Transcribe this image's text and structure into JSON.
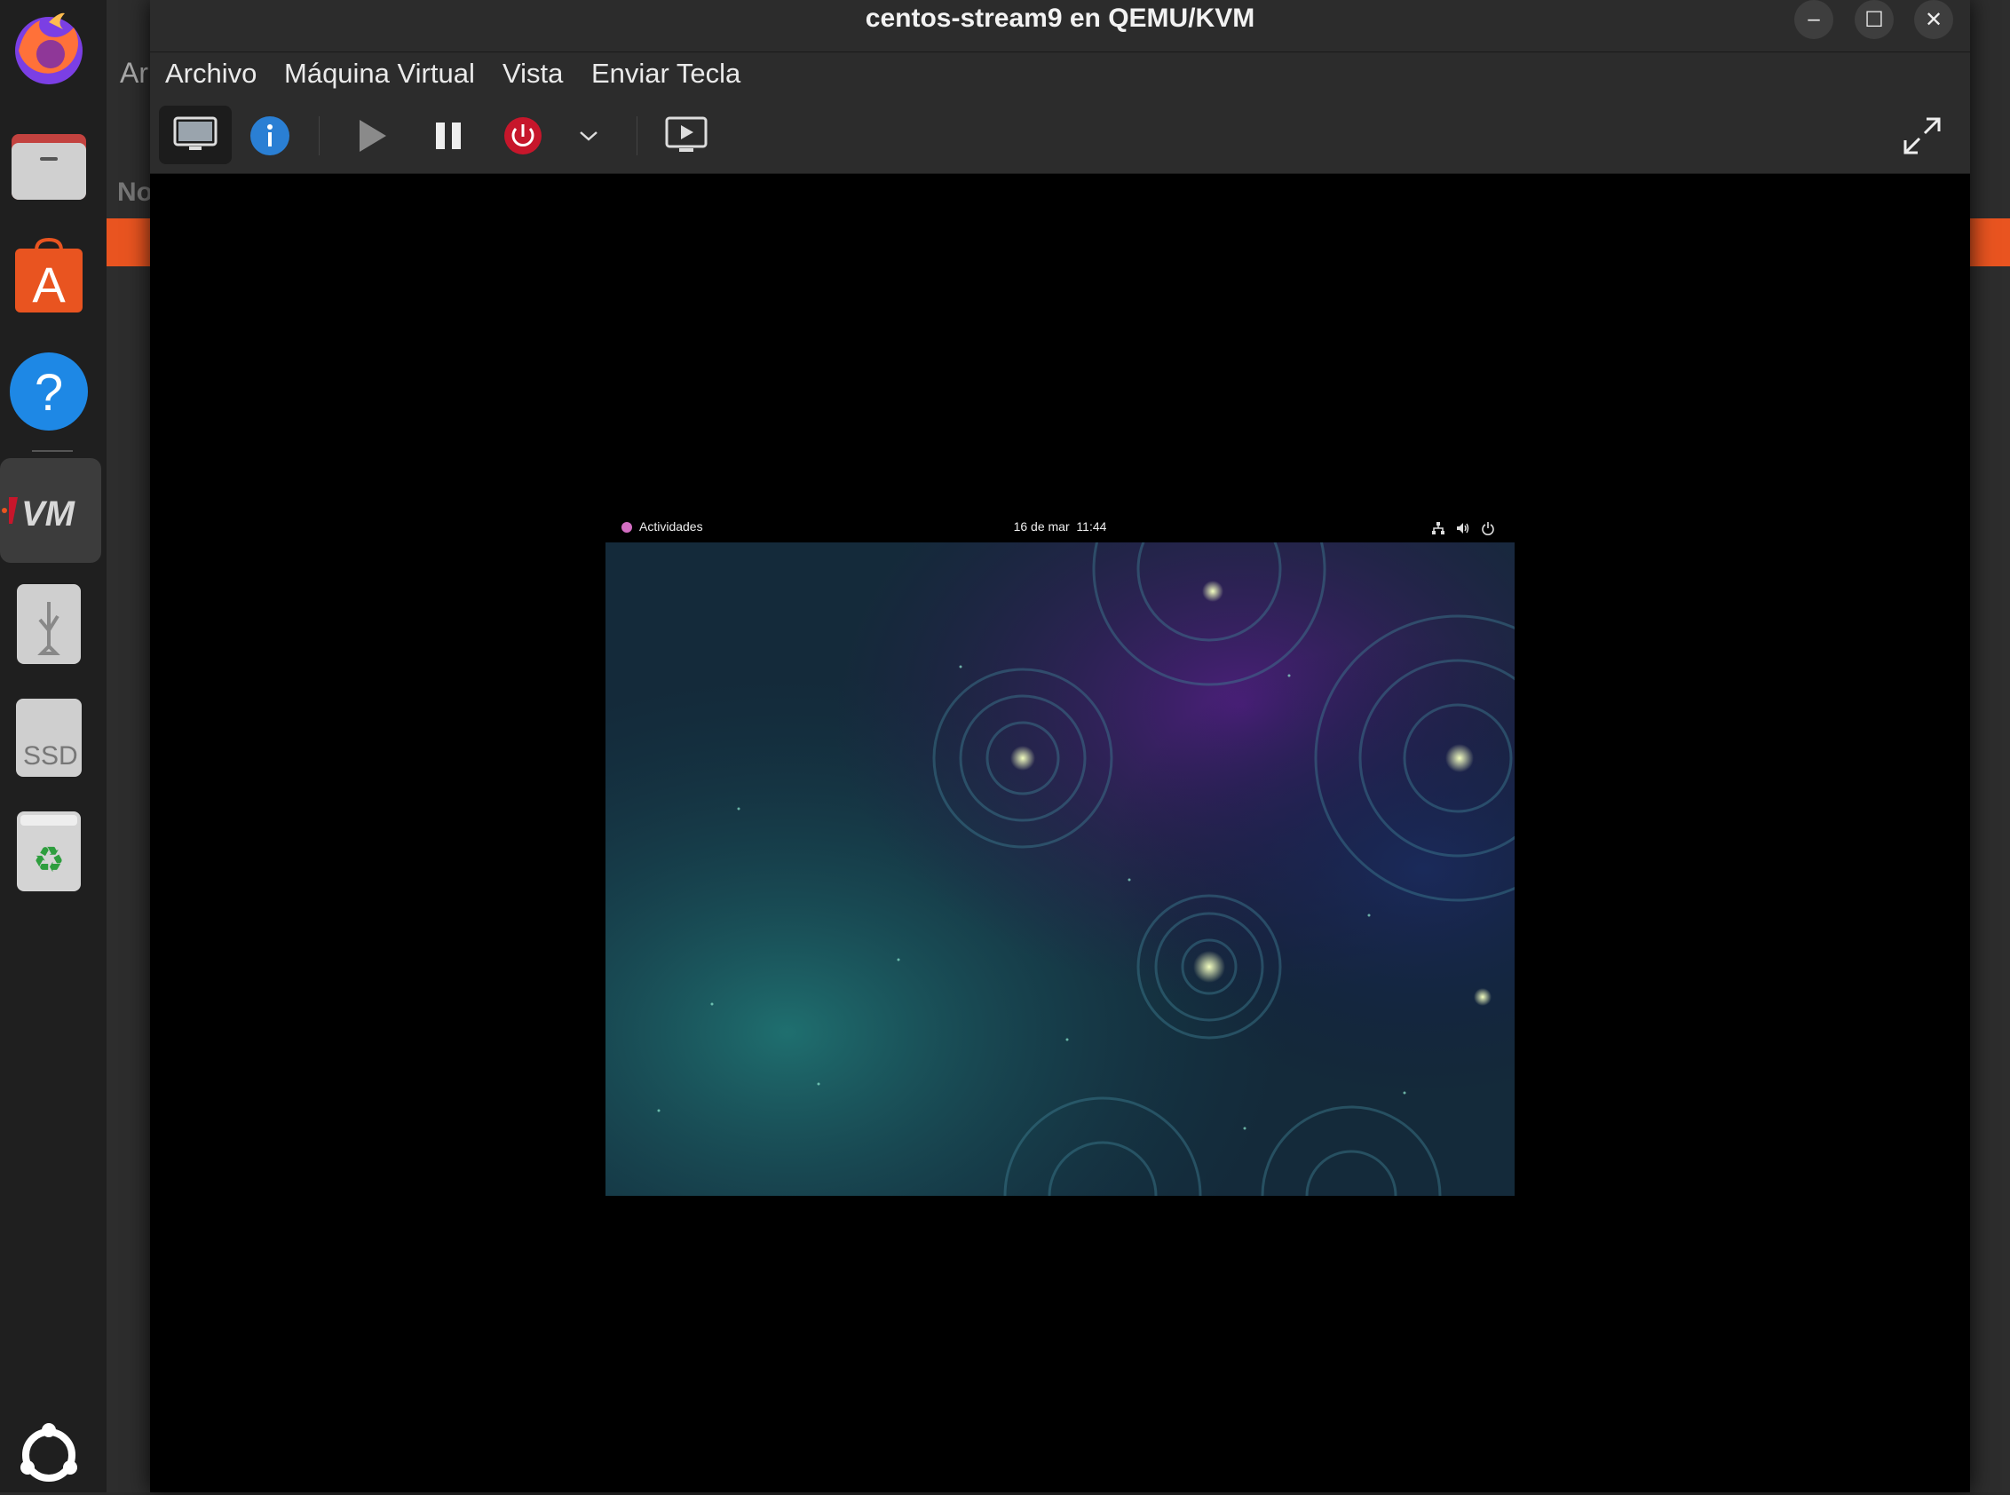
{
  "window": {
    "title": "centos-stream9 en QEMU/KVM",
    "minimize_label": "–",
    "maximize_label": "☐",
    "close_label": "✕"
  },
  "menubar": {
    "items": [
      "Archivo",
      "Máquina Virtual",
      "Vista",
      "Enviar Tecla"
    ]
  },
  "background_window": {
    "menu_fragment": "Ar",
    "column_fragment": "No"
  },
  "toolbar": {
    "buttons": [
      {
        "icon": "monitor-icon",
        "active": true
      },
      {
        "icon": "info-icon"
      },
      {
        "icon": "play-icon"
      },
      {
        "icon": "pause-icon"
      },
      {
        "icon": "power-icon"
      },
      {
        "icon": "chevron-down-icon"
      },
      {
        "icon": "screenshot-icon"
      },
      {
        "icon": "fullscreen-icon"
      }
    ]
  },
  "guest": {
    "activities_label": "Actividades",
    "clock": "16 de mar  11:44",
    "tray_icons": [
      "network-icon",
      "volume-icon",
      "power-icon"
    ]
  },
  "dock": {
    "items": [
      "firefox-icon",
      "files-icon",
      "app-center-icon",
      "help-icon",
      "virt-manager-icon",
      "usb-drive-icon",
      "ssd-drive-icon",
      "trash-icon",
      "ubuntu-logo-icon"
    ],
    "ssd_label": "SSD",
    "virt_label": "VM"
  },
  "colors": {
    "accent": "#e95420",
    "power": "#c7162b",
    "info": "#2a7fd4"
  }
}
